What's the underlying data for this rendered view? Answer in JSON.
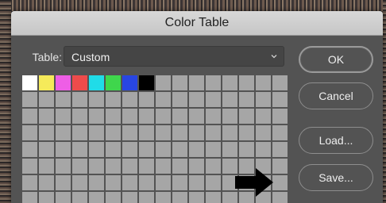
{
  "dialog": {
    "title": "Color Table"
  },
  "table": {
    "label": "Table:",
    "selected": "Custom"
  },
  "buttons": {
    "ok": "OK",
    "cancel": "Cancel",
    "load": "Load...",
    "save": "Save..."
  },
  "swatches": {
    "filled": [
      "#ffffff",
      "#f5ea5a",
      "#ee5ee6",
      "#ee4b4b",
      "#20dce8",
      "#3fd64c",
      "#2846e2",
      "#000000"
    ],
    "total_cells": 128,
    "columns": 16
  },
  "icons": {
    "chevron": "chevron-down-icon",
    "arrow": "arrow-right-icon"
  }
}
